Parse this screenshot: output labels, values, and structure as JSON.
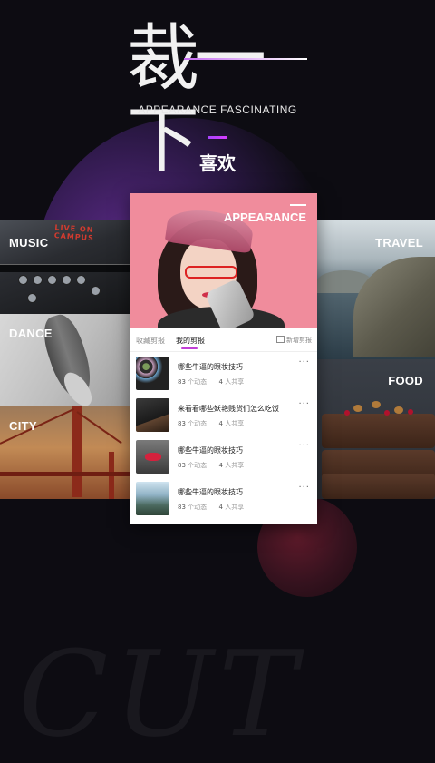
{
  "hero": {
    "title": "裁一下",
    "subtitle": "APPEARANCE FASCINATING",
    "section_title": "喜欢"
  },
  "tiles": {
    "music": "MUSIC",
    "dance": "DANCE",
    "city": "CITY",
    "travel": "TRAVEL",
    "food": "FOOD",
    "appearance": "APPEARANCE"
  },
  "music_sign": "LIVE ON CAMPUS",
  "card": {
    "tabs": [
      "收藏剪报",
      "我的剪报"
    ],
    "active_tab": 1,
    "new_clip_label": "新增剪报",
    "items": [
      {
        "title": "哪些牛逼的眼妆技巧",
        "count": "83",
        "count_label": "个动态",
        "shares": "4",
        "shares_label": "人共享",
        "thumb": "cosmetics-flatlay"
      },
      {
        "title": "来看看哪些妖艳贱货们怎么吃饭",
        "count": "83",
        "count_label": "个动态",
        "shares": "4",
        "shares_label": "人共享",
        "thumb": "food-dark"
      },
      {
        "title": "哪些牛逼的眼妆技巧",
        "count": "83",
        "count_label": "个动态",
        "shares": "4",
        "shares_label": "人共享",
        "thumb": "red-lips"
      },
      {
        "title": "哪些牛逼的眼妆技巧",
        "count": "83",
        "count_label": "个动态",
        "shares": "4",
        "shares_label": "人共享",
        "thumb": "mountain-lake"
      }
    ]
  },
  "background_word": "CUT",
  "colors": {
    "background": "#0d0c12",
    "accent": "#c13fd6",
    "photo_bg": "#f08c9c"
  }
}
